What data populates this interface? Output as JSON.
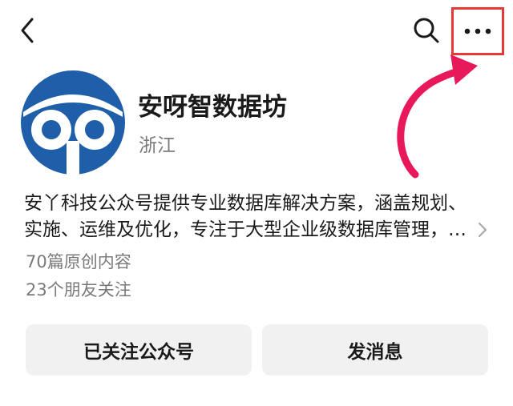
{
  "header": {
    "back_icon": "chevron-left-icon",
    "search_icon": "search-icon",
    "more_icon": "more-horizontal-icon"
  },
  "account": {
    "name": "安呀智数据坊",
    "region": "浙江",
    "logo_icon": "owl-logo",
    "brand_color": "#1f5ea8",
    "description": "安丫科技公众号提供专业数据库解决方案，涵盖规划、实施、运维及优化，专注于大型企业级数据库管理，展…",
    "original_articles": "70篇原创内容",
    "friends_following": "23个朋友关注"
  },
  "actions": {
    "followed_label": "已关注公众号",
    "message_label": "发消息"
  },
  "annotation": {
    "highlight_color": "#e53935",
    "arrow_color": "#e8195a"
  }
}
